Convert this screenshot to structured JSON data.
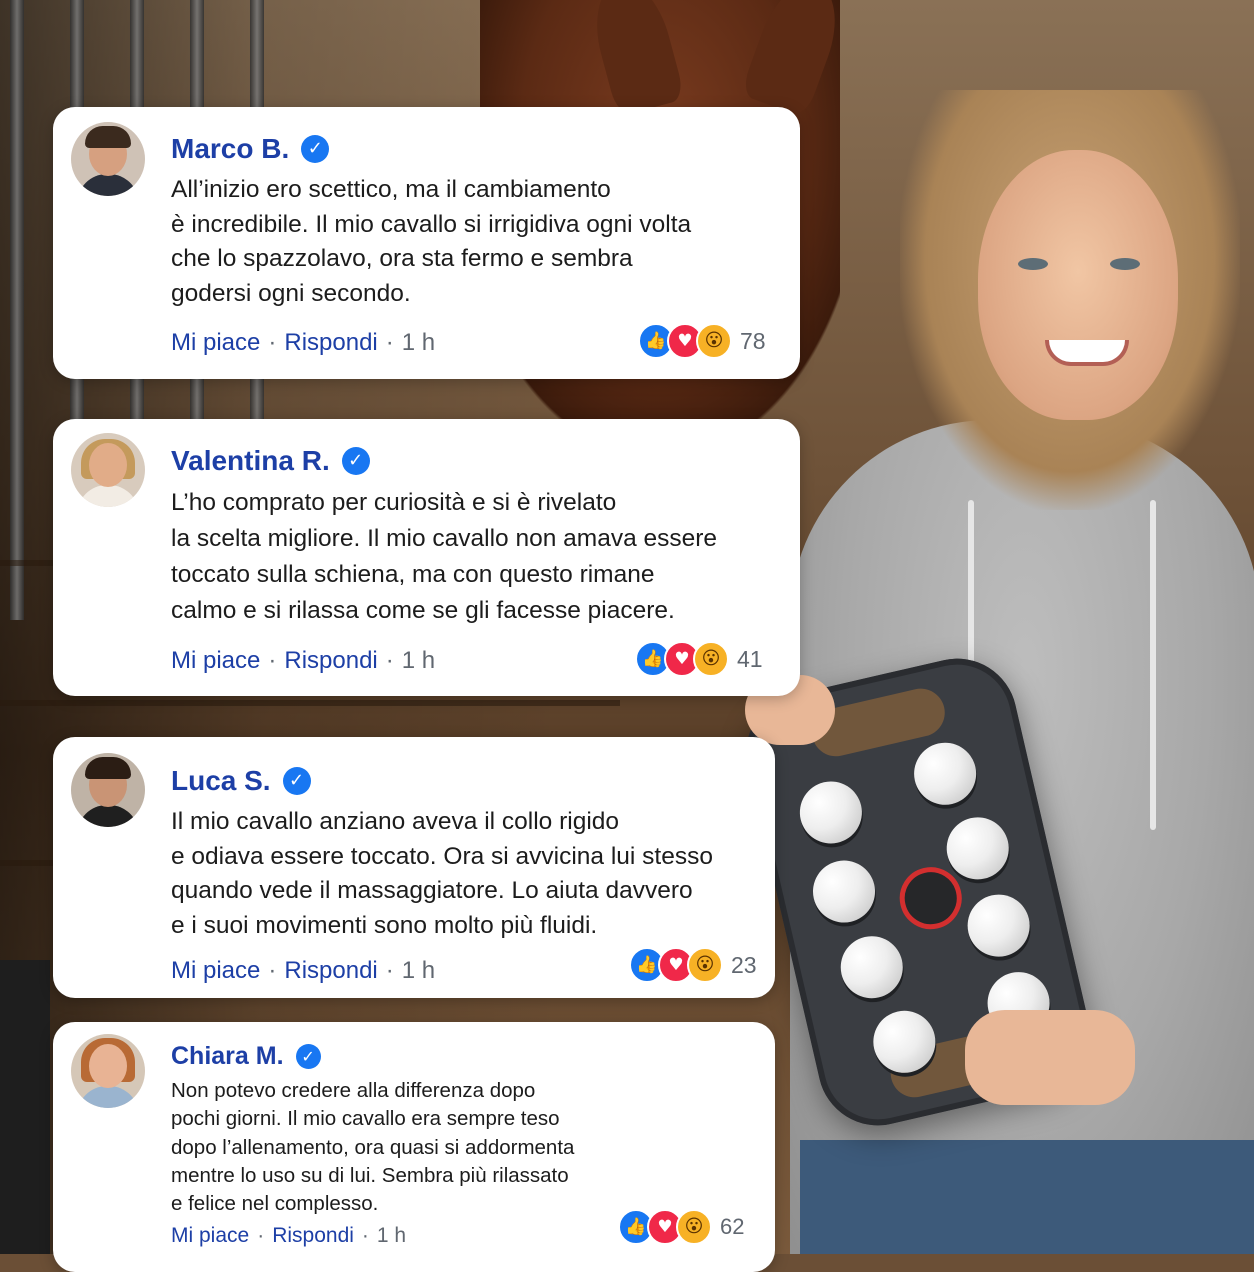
{
  "comments": [
    {
      "name": "Marco B.",
      "text": "All’inizio ero scettico, ma il cambiamento\nè incredibile. Il mio cavallo si irrigidiva ogni volta\nche lo spazzolavo, ora sta fermo e sembra\ngodersi ogni secondo.",
      "like_label": "Mi piace",
      "reply_label": "Rispondi",
      "separator": "·",
      "time": "1 h",
      "reaction_count": "78",
      "reactions": [
        "like",
        "love",
        "wow"
      ]
    },
    {
      "name": "Valentina R.",
      "text": "L’ho comprato per curiosità e si è rivelato\nla scelta migliore. Il mio cavallo non amava essere\ntoccato sulla schiena, ma con questo rimane\ncalmo e si rilassa come se gli facesse piacere.",
      "like_label": "Mi piace",
      "reply_label": "Rispondi",
      "separator": "·",
      "time": "1 h",
      "reaction_count": "41",
      "reactions": [
        "like",
        "love",
        "wow"
      ]
    },
    {
      "name": "Luca S.",
      "text": "Il mio cavallo anziano aveva il collo rigido\ne odiava essere toccato. Ora si avvicina lui stesso\nquando vede il massaggiatore. Lo aiuta davvero\ne i suoi movimenti sono molto più fluidi.",
      "like_label": "Mi piace",
      "reply_label": "Rispondi",
      "separator": "·",
      "time": "1 h",
      "reaction_count": "23",
      "reactions": [
        "like",
        "love",
        "wow"
      ]
    },
    {
      "name": "Chiara M.",
      "text": "Non potevo credere alla differenza dopo\npochi giorni. Il mio cavallo era sempre teso\ndopo l’allenamento, ora quasi si addormenta\nmentre lo uso su di lui. Sembra più rilassato\ne felice nel complesso.",
      "like_label": "Mi piace",
      "reply_label": "Rispondi",
      "separator": "·",
      "time": "1 h",
      "reaction_count": "62",
      "reactions": [
        "like",
        "love",
        "wow"
      ]
    }
  ],
  "icons": {
    "verified": "✓",
    "like": "👍",
    "love": "♥",
    "wow": "😮"
  },
  "colors": {
    "name": "#1d3fa6",
    "action": "#1d3fa6",
    "muted": "#606770",
    "verified": "#1877f2",
    "like": "#1877f2",
    "love": "#f02849",
    "wow": "#f7b125"
  }
}
